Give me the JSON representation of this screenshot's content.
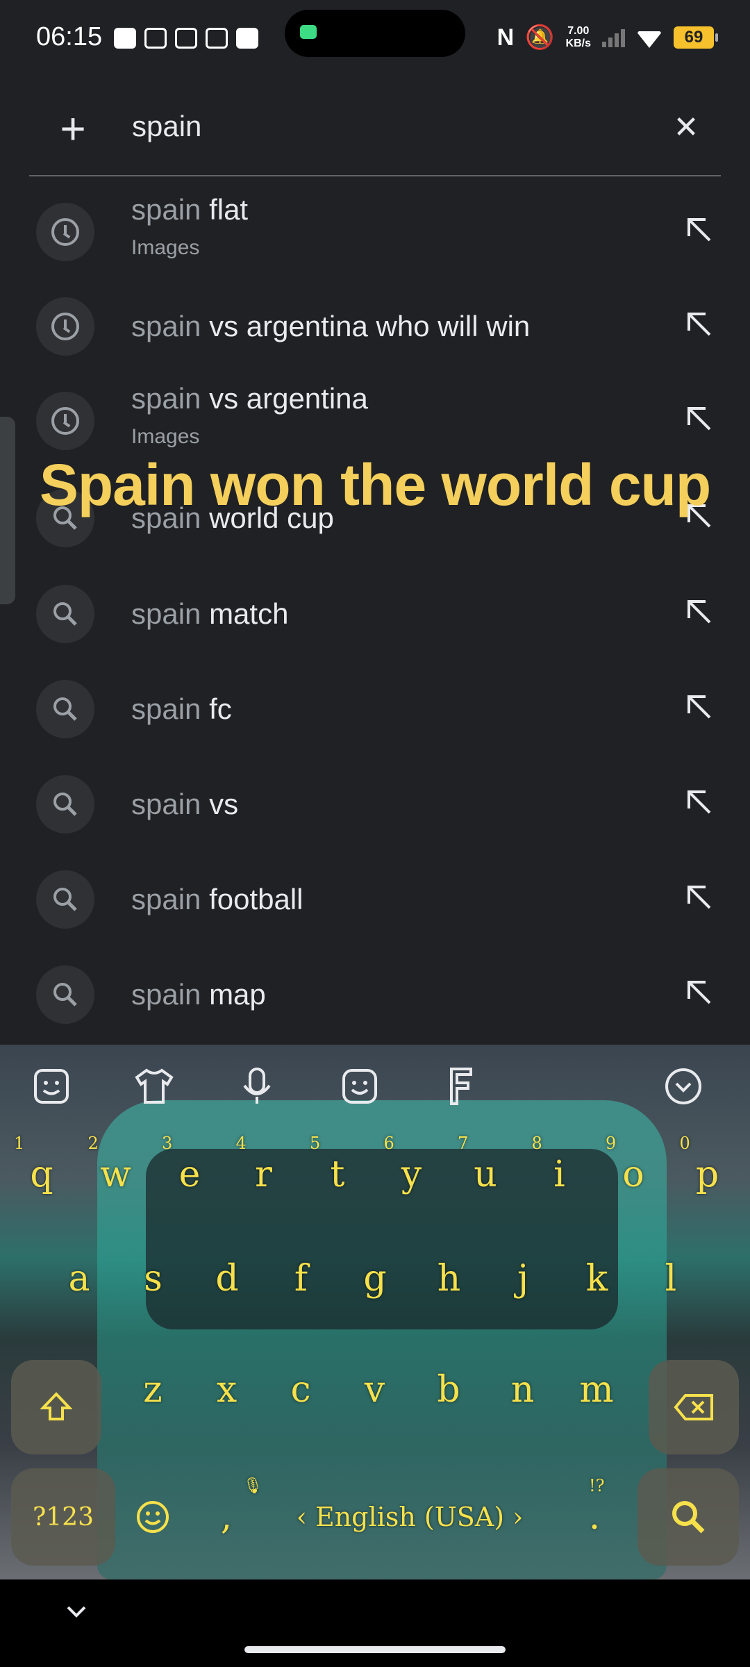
{
  "status_bar": {
    "time": "06:15",
    "network_speed_value": "7.00",
    "network_speed_unit": "KB/s",
    "battery": "69"
  },
  "search": {
    "query": "spain",
    "add_icon": "plus-icon",
    "clear_icon": "close-icon"
  },
  "suggestions": [
    {
      "prefix": "spain",
      "rest": " flat",
      "sub": "Images",
      "icon": "history-icon"
    },
    {
      "prefix": "spain",
      "rest": " vs argentina who will win",
      "sub": "",
      "icon": "history-icon"
    },
    {
      "prefix": "spain",
      "rest": " vs argentina",
      "sub": "Images",
      "icon": "history-icon"
    },
    {
      "prefix": "spain",
      "rest": " world cup",
      "sub": "",
      "icon": "search-icon"
    },
    {
      "prefix": "spain",
      "rest": " match",
      "sub": "",
      "icon": "search-icon"
    },
    {
      "prefix": "spain",
      "rest": " fc",
      "sub": "",
      "icon": "search-icon"
    },
    {
      "prefix": "spain",
      "rest": " vs",
      "sub": "",
      "icon": "search-icon"
    },
    {
      "prefix": "spain",
      "rest": " football",
      "sub": "",
      "icon": "search-icon"
    },
    {
      "prefix": "spain",
      "rest": " map",
      "sub": "",
      "icon": "search-icon"
    }
  ],
  "overlay_caption": "Spain won the world cup",
  "keyboard": {
    "row1": [
      {
        "k": "q",
        "n": "1"
      },
      {
        "k": "w",
        "n": "2"
      },
      {
        "k": "e",
        "n": "3"
      },
      {
        "k": "r",
        "n": "4"
      },
      {
        "k": "t",
        "n": "5"
      },
      {
        "k": "y",
        "n": "6"
      },
      {
        "k": "u",
        "n": "7"
      },
      {
        "k": "i",
        "n": "8"
      },
      {
        "k": "o",
        "n": "9"
      },
      {
        "k": "p",
        "n": "0"
      }
    ],
    "row2": [
      "a",
      "s",
      "d",
      "f",
      "g",
      "h",
      "j",
      "k",
      "l"
    ],
    "row3": [
      "z",
      "x",
      "c",
      "v",
      "b",
      "n",
      "m"
    ],
    "symbols_key": "?123",
    "comma_key": ",",
    "language": "English (USA)",
    "period_key": ".",
    "period_hint": "!?",
    "accent_color": "#f7e14b"
  }
}
